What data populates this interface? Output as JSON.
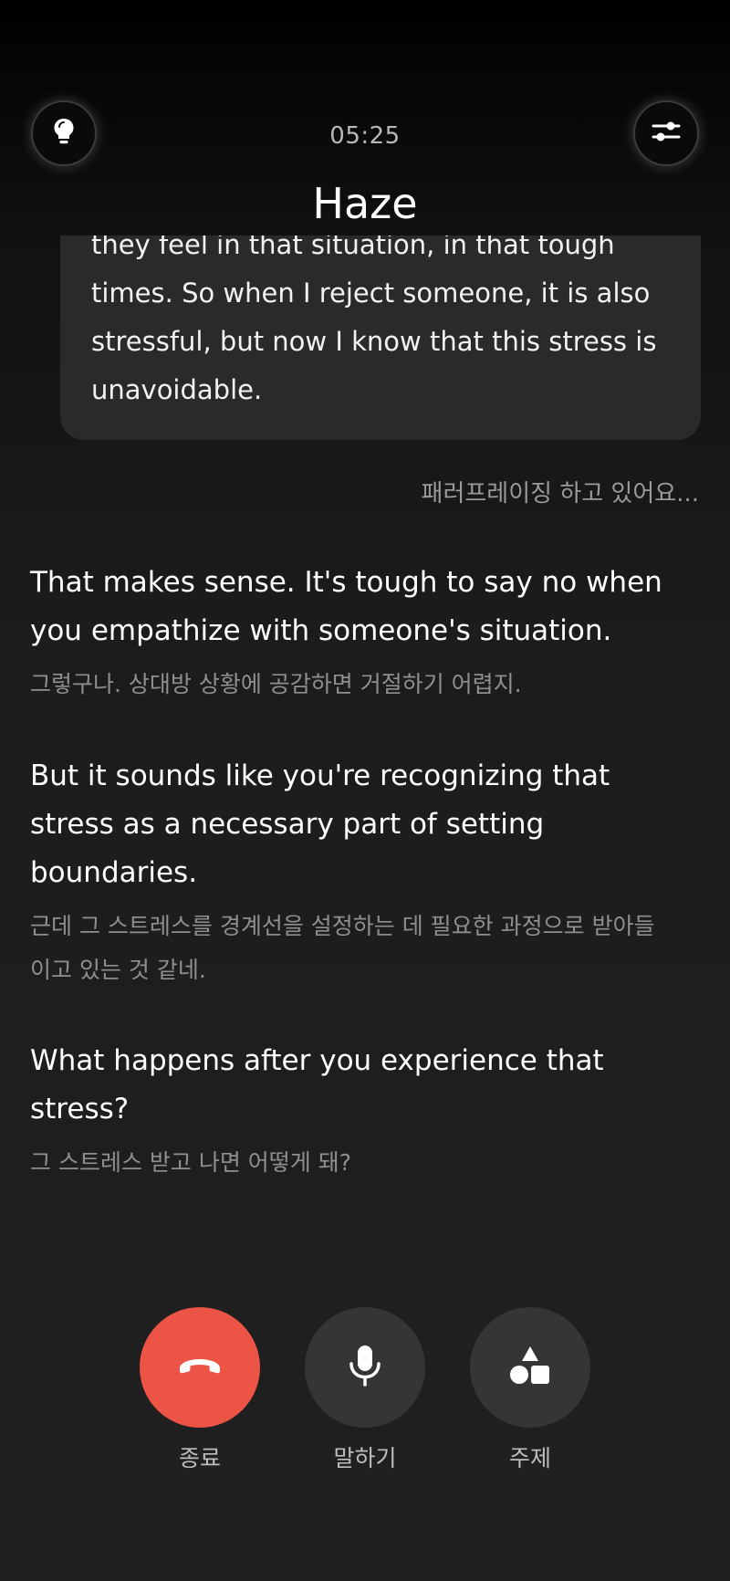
{
  "header": {
    "timer": "05:25",
    "title": "Haze",
    "hint_icon": "lightbulb-icon",
    "settings_icon": "sliders-icon"
  },
  "conversation": {
    "user_message": "they feel in that situation, in that tough times. So when I reject someone, it is also stressful, but now I know that this stress is unavoidable.",
    "status": "패러프레이징 하고 있어요...",
    "ai_messages": [
      {
        "en": "That makes sense. It's tough to say no when you empathize with someone's situation.",
        "ko": "그렇구나. 상대방 상황에 공감하면 거절하기 어렵지."
      },
      {
        "en": "But it sounds like you're recognizing that stress as a necessary part of setting boundaries.",
        "ko": "근데 그 스트레스를 경계선을 설정하는 데 필요한 과정으로 받아들이고 있는 것 같네."
      },
      {
        "en": "What happens after you experience that stress?",
        "ko": "그 스트레스 받고 나면 어떻게 돼?"
      }
    ]
  },
  "controls": {
    "end": {
      "label": "종료",
      "icon": "hang-up-icon",
      "color": "#ec5446"
    },
    "speak": {
      "label": "말하기",
      "icon": "microphone-icon"
    },
    "topic": {
      "label": "주제",
      "icon": "shapes-icon"
    }
  }
}
